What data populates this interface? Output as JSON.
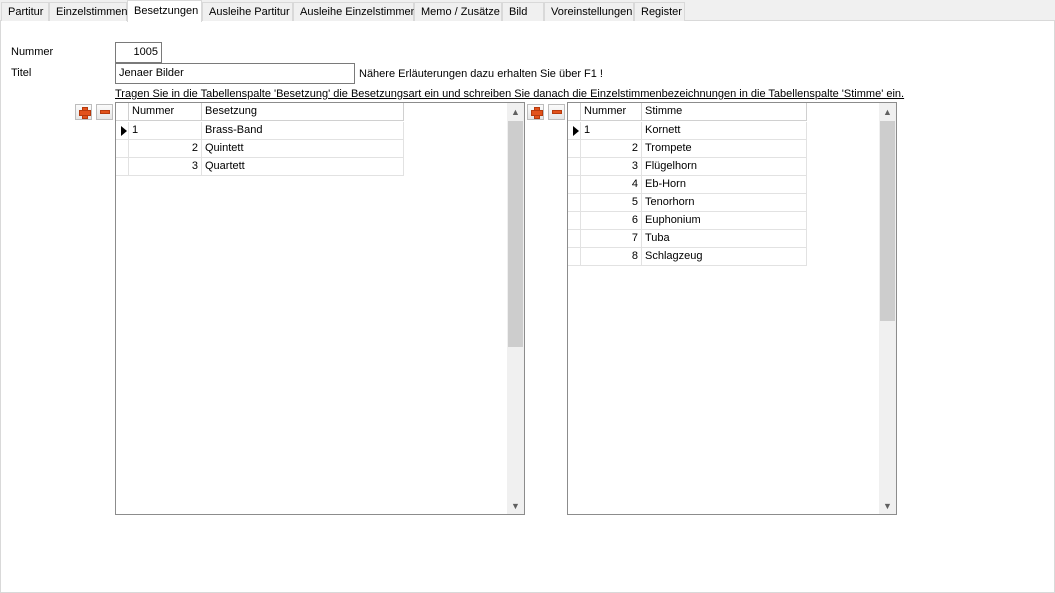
{
  "tabs": [
    {
      "label": "Partitur",
      "active": false
    },
    {
      "label": "Einzelstimmen",
      "active": false
    },
    {
      "label": "Besetzungen",
      "active": true
    },
    {
      "label": "Ausleihe Partitur",
      "active": false
    },
    {
      "label": "Ausleihe Einzelstimmen",
      "active": false
    },
    {
      "label": "Memo / Zusätze",
      "active": false
    },
    {
      "label": "Bild",
      "active": false
    },
    {
      "label": "Voreinstellungen",
      "active": false
    },
    {
      "label": "Register",
      "active": false
    }
  ],
  "form": {
    "nummer_label": "Nummer",
    "nummer_value": "1005",
    "titel_label": "Titel",
    "titel_value": "Jenaer Bilder",
    "hint": "Nähere Erläuterungen dazu erhalten Sie über F1 !",
    "instruction": "Tragen Sie in die Tabellenspalte 'Besetzung' die Besetzungsart ein und schreiben Sie danach die Einzelstimmenbezeichnungen in die Tabellenspalte 'Stimme' ein."
  },
  "besetzung_grid": {
    "columns": [
      "Nummer",
      "Besetzung"
    ],
    "rows": [
      {
        "nummer": "1",
        "name": "Brass-Band",
        "current": true
      },
      {
        "nummer": "2",
        "name": "Quintett",
        "current": false
      },
      {
        "nummer": "3",
        "name": "Quartett",
        "current": false
      }
    ]
  },
  "stimme_grid": {
    "columns": [
      "Nummer",
      "Stimme"
    ],
    "rows": [
      {
        "nummer": "1",
        "name": "Kornett",
        "current": true
      },
      {
        "nummer": "2",
        "name": "Trompete",
        "current": false
      },
      {
        "nummer": "3",
        "name": "Flügelhorn",
        "current": false
      },
      {
        "nummer": "4",
        "name": "Eb-Horn",
        "current": false
      },
      {
        "nummer": "5",
        "name": "Tenorhorn",
        "current": false
      },
      {
        "nummer": "6",
        "name": "Euphonium",
        "current": false
      },
      {
        "nummer": "7",
        "name": "Tuba",
        "current": false
      },
      {
        "nummer": "8",
        "name": "Schlagzeug",
        "current": false
      }
    ]
  },
  "icons": {
    "add": "plus-icon",
    "remove": "minus-icon",
    "row_indicator": "row-pointer-icon",
    "scroll_up": "chevron-up-icon",
    "scroll_down": "chevron-down-icon"
  },
  "colors": {
    "accent_icon": "#e2521b",
    "tab_bg": "#f0f0f0",
    "scroll_thumb": "#cdcdcd"
  }
}
